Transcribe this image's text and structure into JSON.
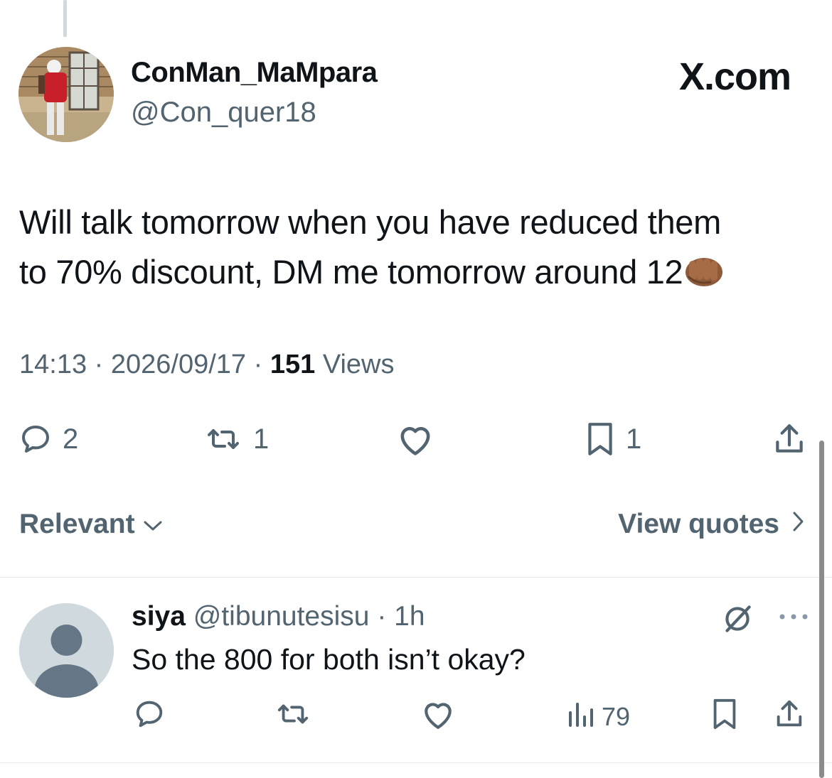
{
  "watermark": "X.com",
  "tweet": {
    "display_name": "ConMan_MaMpara",
    "handle": "@Con_quer18",
    "text_line1": "Will talk tomorrow when you have reduced them",
    "text_line2": "to 70% discount, DM me tomorrow around 12",
    "emoji": "oncoming-fist-medium-dark-skin",
    "time": "14:13",
    "separator": "·",
    "date": "2026/09/17",
    "views_count": "151",
    "views_label": "Views",
    "replies": "2",
    "reposts": "1",
    "bookmarks": "1"
  },
  "sort": {
    "label": "Relevant"
  },
  "quotes_link": {
    "label": "View quotes"
  },
  "reply": {
    "name": "siya",
    "handle": "@tibunutesisu",
    "separator": "·",
    "age": "1h",
    "text": "So the 800 for both isn’t okay?",
    "views": "79"
  },
  "icons": [
    "reply-icon",
    "repost-icon",
    "like-icon",
    "bookmark-icon",
    "share-icon",
    "chevron-down-icon",
    "chevron-right-icon",
    "grok-icon",
    "more-icon",
    "views-icon"
  ],
  "colors": {
    "text": "#0f1419",
    "secondary": "#536471",
    "divider": "#e5e9eb"
  }
}
